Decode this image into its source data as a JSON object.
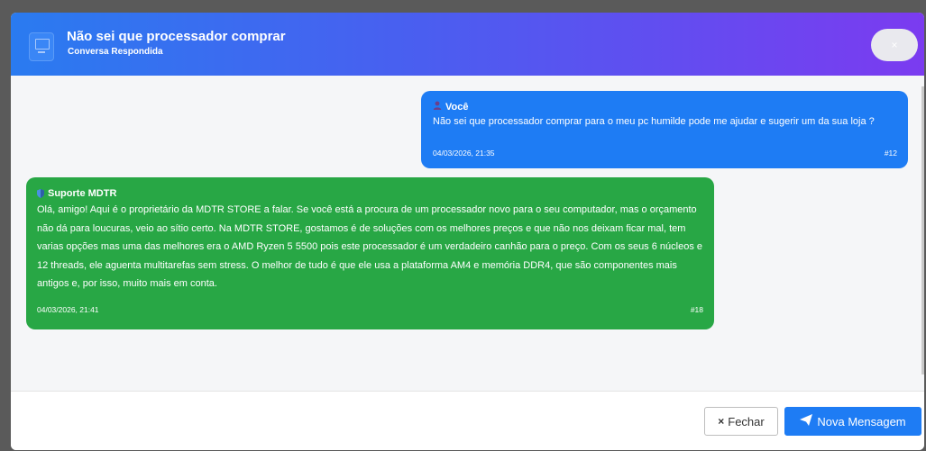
{
  "header": {
    "title": "Não sei que processador comprar",
    "subtitle": "Conversa Respondida",
    "close_label": "×",
    "gradient_start": "#2a7bf0",
    "gradient_end": "#7b3bf0"
  },
  "messages": [
    {
      "sender": "Você",
      "sender_icon": "user-icon",
      "text": "Não sei que processador comprar para o meu pc humilde pode me ajudar e sugerir um da sua loja ?",
      "timestamp": "04/03/2026, 21:35",
      "number": "#12",
      "color": "#1e7cf4"
    },
    {
      "sender": "Suporte MDTR",
      "sender_icon": "shield-icon",
      "text": "Olá, amigo! Aqui é o proprietário da MDTR STORE a falar. Se você está a procura de um processador novo para o seu computador, mas o orçamento não dá para loucuras, veio ao sítio certo. Na MDTR STORE, gostamos é de soluções com os melhores preços e que não nos deixam ficar mal, tem varias opções mas uma das melhores era o AMD Ryzen 5 5500 pois este processador é um verdadeiro canhão para o preço. Com os seus 6 núcleos e 12 threads, ele aguenta multitarefas sem stress. O melhor de tudo é que ele usa a plataforma AM4 e memória DDR4, que são componentes mais antigos e, por isso, muito mais em conta.",
      "timestamp": "04/03/2026, 21:41",
      "number": "#18",
      "color": "#28a745"
    }
  ],
  "footer": {
    "close_button": "Fechar",
    "close_icon": "×",
    "new_message_button": "Nova Mensagem",
    "new_message_icon": "paper-plane-icon"
  }
}
